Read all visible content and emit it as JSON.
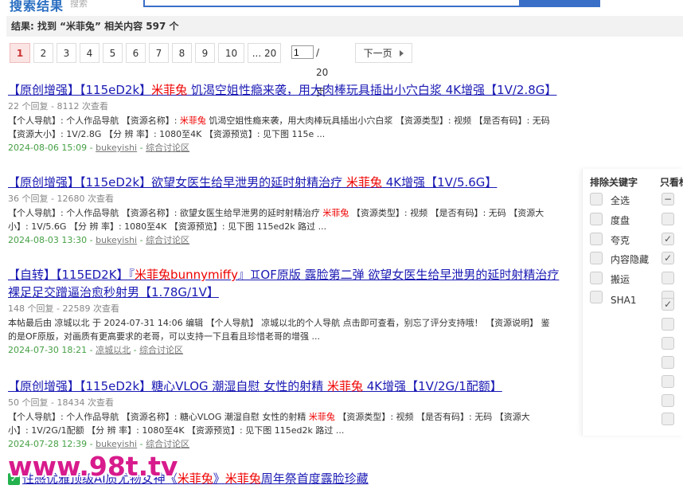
{
  "header": {
    "logo_text": "搜索结果",
    "logo_sub": "搜索"
  },
  "result_summary": "结果: 找到 “米菲兔” 相关内容 597 个",
  "pager": {
    "pages": [
      "1",
      "2",
      "3",
      "4",
      "5",
      "6",
      "7",
      "8",
      "9",
      "10",
      "... 20"
    ],
    "current": "1",
    "input_value": "1",
    "total_text": "/ 20 页",
    "next_label": "下一页"
  },
  "results": [
    {
      "title_pre": "【原创增强】【115eD2k】",
      "title_hl": "米菲兔",
      "title_post": " 饥渴空姐性瘾来袭，用大肉棒玩具插出小穴白浆 4K增强【1V/2.8G】",
      "meta": "22 个回复 - 8112 次查看",
      "desc1_pre": "【个人导航】: 个人作品导航 【资源名称】: ",
      "desc1_hl": "米菲兔",
      "desc1_post": " 饥渴空姐性瘾来袭，用大肉棒玩具插出小穴白浆 【资源类型】: 视频 【是否有码】: 无码",
      "desc2": "【资源大小】: 1V/2.8G 【分 辨 率】: 1080至4K 【资源预览】: 见下图 115e ...",
      "date": "2024-08-06 15:09",
      "author": "bukeyishi",
      "forum": "综合讨论区"
    },
    {
      "title_pre": "【原创增强】【115eD2k】欲望女医生给早泄男的延时射精治疗 ",
      "title_hl": "米菲兔",
      "title_post": " 4K增强【1V/5.6G】",
      "meta": "36 个回复 - 12680 次查看",
      "desc1_pre": "【个人导航】: 个人作品导航 【资源名称】: 欲望女医生给早泄男的延时射精治疗 ",
      "desc1_hl": "米菲兔",
      "desc1_post": " 【资源类型】: 视频 【是否有码】: 无码 【资源大",
      "desc2": "小】: 1V/5.6G 【分 辨 率】: 1080至4K 【资源预览】: 见下图 115ed2k 路过 ...",
      "date": "2024-08-03 13:30",
      "author": "bukeyishi",
      "forum": "综合讨论区"
    },
    {
      "title_pre": "【自转】【115ED2K】『",
      "title_hl": "米菲兔bunnymiffy",
      "title_post": "』♊OF原版 露脸第二弹 欲望女医生给早泄男的延时射精治疗",
      "title_line2": "裸足足交蹭逼治愈秒射男【1.78G/1V】",
      "meta": "148 个回复 - 22589 次查看",
      "desc1_pre": "本帖最后由 凉城以北 于 2024-07-31 14:06 编辑 【个人导航】 凉城以北的个人导航 点击即可查看，别忘了评分支持哦！ 【资源说明】 鉴",
      "desc1_hl": "",
      "desc1_post": "",
      "desc2": "的是OF原版，对画质有更高要求的老哥，可以支持一下且看且珍惜老哥的增强 ...",
      "date": "2024-07-30 18:21",
      "author": "凉城以北",
      "forum": "综合讨论区"
    },
    {
      "title_pre": "【原创增强】【115eD2k】糖心VLOG 潮湿自慰 女性的射精 ",
      "title_hl": "米菲兔",
      "title_post": " 4K增强【1V/2G/1配额】",
      "meta": "50 个回复 - 18434 次查看",
      "desc1_pre": "【个人导航】: 个人作品导航 【资源名称】: 糖心VLOG 潮湿自慰 女性的射精 ",
      "desc1_hl": "米菲兔",
      "desc1_post": " 【资源类型】: 视频 【是否有码】: 无码 【资源大",
      "desc2": "小】: 1V/2G/1配额 【分 辨 率】: 1080至4K 【资源预览】: 见下图 115ed2k 路过 ...",
      "date": "2024-07-28 12:39",
      "author": "bukeyishi",
      "forum": "综合讨论区"
    }
  ],
  "last_result": {
    "title_pre": "性感优雅顶级AI质尤物女神《",
    "title_hl": "米菲兔",
    "title_mid": "》",
    "title_hl2": "米菲兔",
    "title_post": "周年祭首度露脸珍藏"
  },
  "panel": {
    "exclude_heading": "排除关键字",
    "only_heading": "只看标",
    "exclude_items": [
      "全选",
      "度盘",
      "夸克",
      "内容隐藏",
      "搬运",
      "SHA1"
    ],
    "only_marks": [
      "−",
      "",
      "✓",
      "✓",
      "",
      "",
      "✓",
      "",
      "",
      "",
      "",
      "",
      ""
    ]
  },
  "watermark": "www.98t.tv",
  "colors": {
    "highlight": "#e00000",
    "link": "#1a1ab4",
    "date_green": "#46a046",
    "pager_current_bg": "#fbe4e4"
  }
}
